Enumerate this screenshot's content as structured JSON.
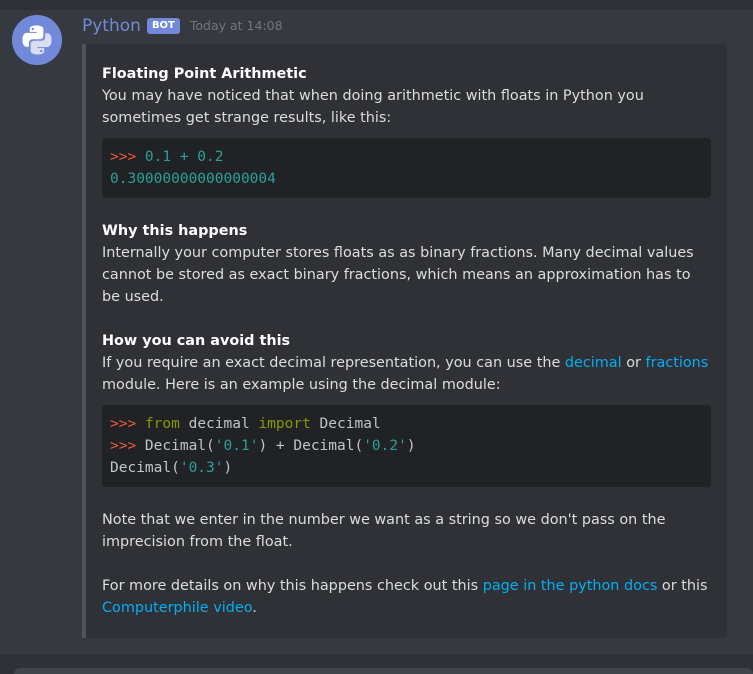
{
  "message": {
    "username": "Python",
    "bot_tag": "BOT",
    "timestamp": "Today at 14:08"
  },
  "embed": {
    "sections": {
      "intro_title": "Floating Point Arithmetic",
      "intro_text": "You may have noticed that when doing arithmetic with floats in Python you sometimes get strange results, like this:",
      "code1": {
        "prompt": ">>>",
        "line1_expr": " 0.1 + 0.2",
        "line2_output": "0.30000000000000004"
      },
      "why_title": "Why this happens",
      "why_text": "Internally your computer stores floats as as binary fractions. Many decimal values cannot be stored as exact binary fractions, which means an approximation has to be used.",
      "avoid_title": "How you can avoid this",
      "avoid_text_before": "If you require an exact decimal representation, you can use the ",
      "link_decimal": "decimal",
      "avoid_text_or": " or ",
      "link_fractions": "fractions",
      "avoid_text_after": " module. Here is an example using the decimal module:",
      "code2": {
        "prompt": ">>>",
        "kw_from": "from",
        "mod_decimal": " decimal ",
        "kw_import": "import",
        "cls_decimal": " Decimal",
        "l2_a": " Decimal(",
        "l2_s1": "'0.1'",
        "l2_b": ") + Decimal(",
        "l2_s2": "'0.2'",
        "l2_c": ")",
        "l3_a": "Decimal(",
        "l3_s": "'0.3'",
        "l3_b": ")"
      },
      "note_text": "Note that we enter in the number we want as a string so we don't pass on the imprecision from the float.",
      "more_before": "For more details on why this happens check out this ",
      "link_docs": "page in the python docs",
      "more_or": " or this ",
      "link_video": "Computerphile video",
      "more_after": "."
    }
  },
  "colors": {
    "background": "#36393f",
    "embed_background": "#2f3136",
    "code_background": "#202225",
    "username": "#7289da",
    "link": "#00b0f4",
    "prompt": "#ef5a36"
  },
  "icons": {
    "avatar": "python-logo-icon"
  }
}
